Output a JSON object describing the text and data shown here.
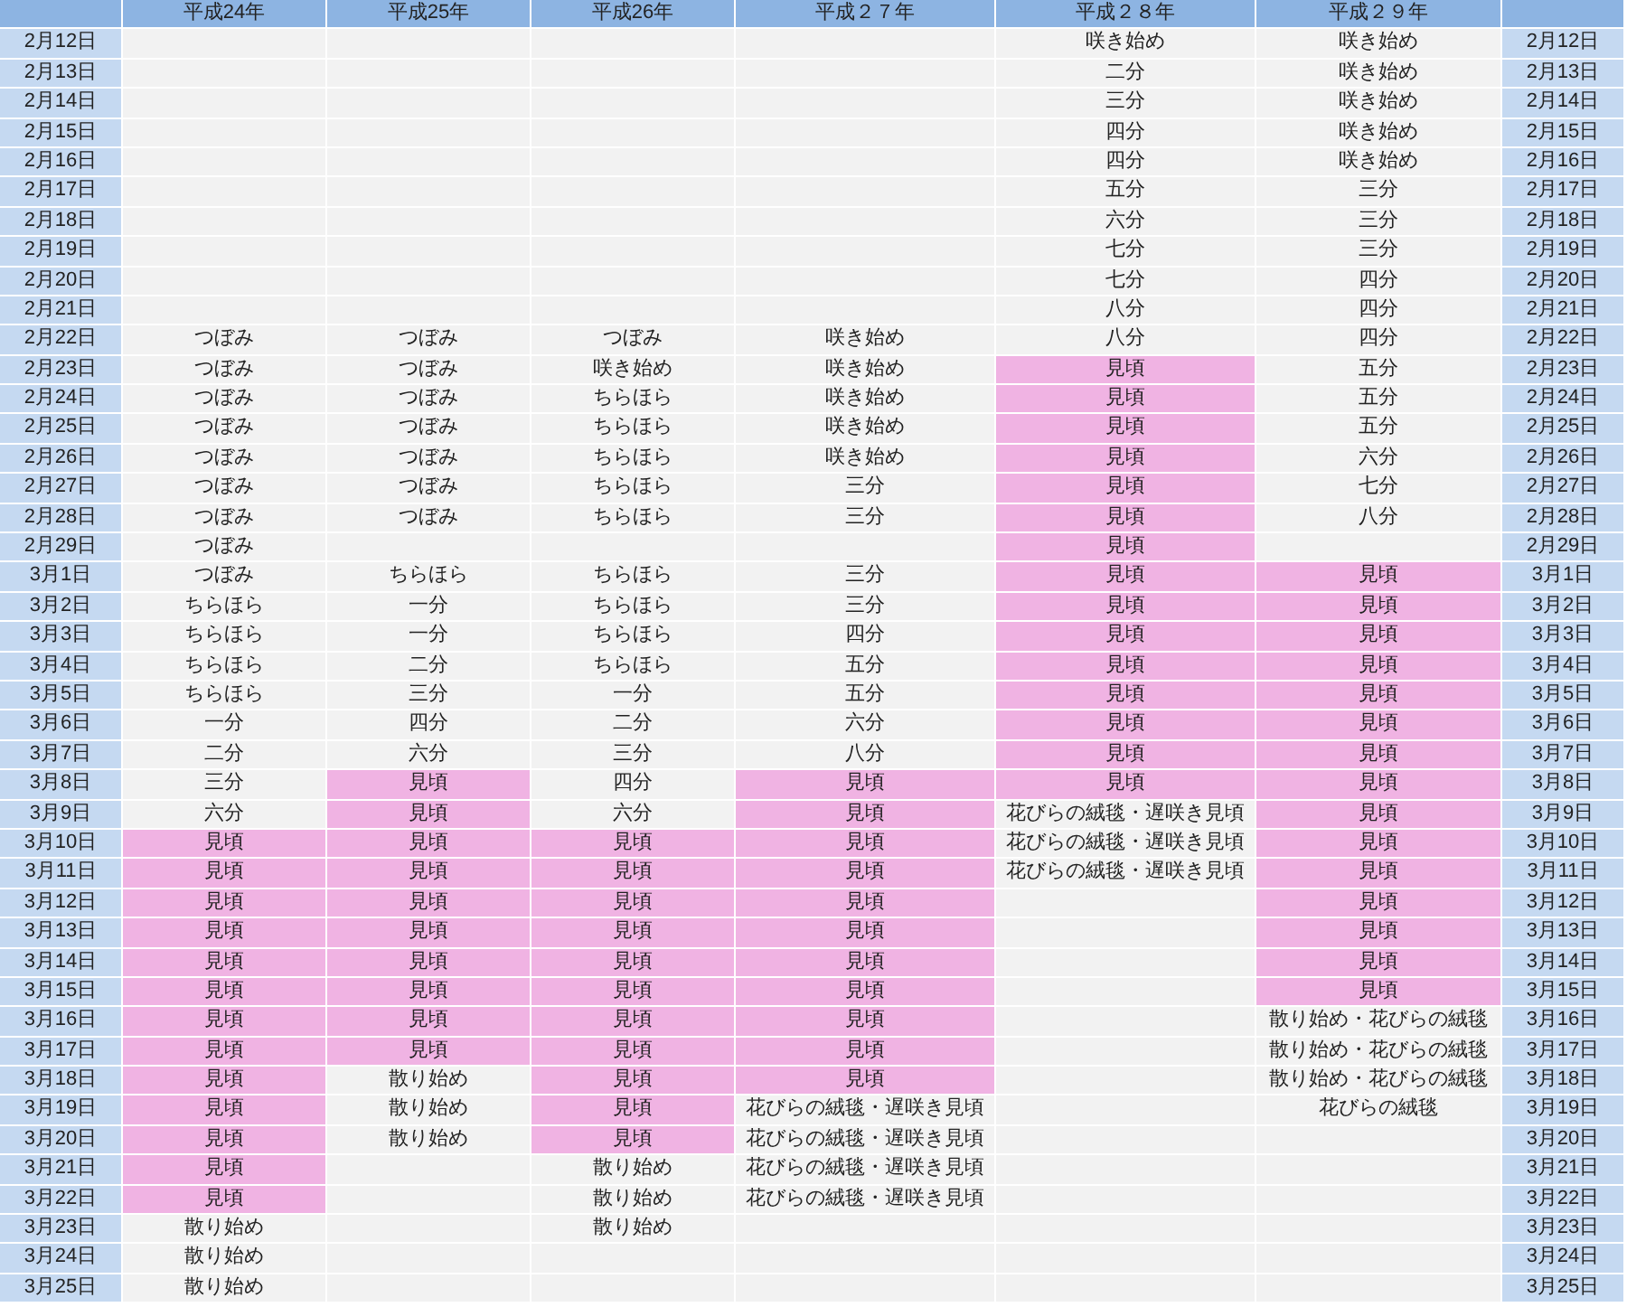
{
  "columns": [
    "平成24年",
    "平成25年",
    "平成26年",
    "平成２７年",
    "平成２８年",
    "平成２９年"
  ],
  "rows": [
    {
      "date": "2月12日",
      "cells": [
        null,
        null,
        null,
        null,
        {
          "text": "咲き始め",
          "highlighted": false
        },
        {
          "text": "咲き始め",
          "highlighted": false
        }
      ],
      "date_right": "2月12日"
    },
    {
      "date": "2月13日",
      "cells": [
        null,
        null,
        null,
        null,
        {
          "text": "二分",
          "highlighted": false
        },
        {
          "text": "咲き始め",
          "highlighted": false
        }
      ],
      "date_right": "2月13日"
    },
    {
      "date": "2月14日",
      "cells": [
        null,
        null,
        null,
        null,
        {
          "text": "三分",
          "highlighted": false
        },
        {
          "text": "咲き始め",
          "highlighted": false
        }
      ],
      "date_right": "2月14日"
    },
    {
      "date": "2月15日",
      "cells": [
        null,
        null,
        null,
        null,
        {
          "text": "四分",
          "highlighted": false
        },
        {
          "text": "咲き始め",
          "highlighted": false
        }
      ],
      "date_right": "2月15日"
    },
    {
      "date": "2月16日",
      "cells": [
        null,
        null,
        null,
        null,
        {
          "text": "四分",
          "highlighted": false
        },
        {
          "text": "咲き始め",
          "highlighted": false
        }
      ],
      "date_right": "2月16日"
    },
    {
      "date": "2月17日",
      "cells": [
        null,
        null,
        null,
        null,
        {
          "text": "五分",
          "highlighted": false
        },
        {
          "text": "三分",
          "highlighted": false
        }
      ],
      "date_right": "2月17日"
    },
    {
      "date": "2月18日",
      "cells": [
        null,
        null,
        null,
        null,
        {
          "text": "六分",
          "highlighted": false
        },
        {
          "text": "三分",
          "highlighted": false
        }
      ],
      "date_right": "2月18日"
    },
    {
      "date": "2月19日",
      "cells": [
        null,
        null,
        null,
        null,
        {
          "text": "七分",
          "highlighted": false
        },
        {
          "text": "三分",
          "highlighted": false
        }
      ],
      "date_right": "2月19日"
    },
    {
      "date": "2月20日",
      "cells": [
        null,
        null,
        null,
        null,
        {
          "text": "七分",
          "highlighted": false
        },
        {
          "text": "四分",
          "highlighted": false
        }
      ],
      "date_right": "2月20日"
    },
    {
      "date": "2月21日",
      "cells": [
        null,
        null,
        null,
        null,
        {
          "text": "八分",
          "highlighted": false
        },
        {
          "text": "四分",
          "highlighted": false
        }
      ],
      "date_right": "2月21日"
    },
    {
      "date": "2月22日",
      "cells": [
        {
          "text": "つぼみ",
          "highlighted": false
        },
        {
          "text": "つぼみ",
          "highlighted": false
        },
        {
          "text": "つぼみ",
          "highlighted": false
        },
        {
          "text": "咲き始め",
          "highlighted": false
        },
        {
          "text": "八分",
          "highlighted": false
        },
        {
          "text": "四分",
          "highlighted": false
        }
      ],
      "date_right": "2月22日"
    },
    {
      "date": "2月23日",
      "cells": [
        {
          "text": "つぼみ",
          "highlighted": false
        },
        {
          "text": "つぼみ",
          "highlighted": false
        },
        {
          "text": "咲き始め",
          "highlighted": false
        },
        {
          "text": "咲き始め",
          "highlighted": false
        },
        {
          "text": "見頃",
          "highlighted": true
        },
        {
          "text": "五分",
          "highlighted": false
        }
      ],
      "date_right": "2月23日"
    },
    {
      "date": "2月24日",
      "cells": [
        {
          "text": "つぼみ",
          "highlighted": false
        },
        {
          "text": "つぼみ",
          "highlighted": false
        },
        {
          "text": "ちらほら",
          "highlighted": false
        },
        {
          "text": "咲き始め",
          "highlighted": false
        },
        {
          "text": "見頃",
          "highlighted": true
        },
        {
          "text": "五分",
          "highlighted": false
        }
      ],
      "date_right": "2月24日"
    },
    {
      "date": "2月25日",
      "cells": [
        {
          "text": "つぼみ",
          "highlighted": false
        },
        {
          "text": "つぼみ",
          "highlighted": false
        },
        {
          "text": "ちらほら",
          "highlighted": false
        },
        {
          "text": "咲き始め",
          "highlighted": false
        },
        {
          "text": "見頃",
          "highlighted": true
        },
        {
          "text": "五分",
          "highlighted": false
        }
      ],
      "date_right": "2月25日"
    },
    {
      "date": "2月26日",
      "cells": [
        {
          "text": "つぼみ",
          "highlighted": false
        },
        {
          "text": "つぼみ",
          "highlighted": false
        },
        {
          "text": "ちらほら",
          "highlighted": false
        },
        {
          "text": "咲き始め",
          "highlighted": false
        },
        {
          "text": "見頃",
          "highlighted": true
        },
        {
          "text": "六分",
          "highlighted": false
        }
      ],
      "date_right": "2月26日"
    },
    {
      "date": "2月27日",
      "cells": [
        {
          "text": "つぼみ",
          "highlighted": false
        },
        {
          "text": "つぼみ",
          "highlighted": false
        },
        {
          "text": "ちらほら",
          "highlighted": false
        },
        {
          "text": "三分",
          "highlighted": false
        },
        {
          "text": "見頃",
          "highlighted": true
        },
        {
          "text": "七分",
          "highlighted": false
        }
      ],
      "date_right": "2月27日"
    },
    {
      "date": "2月28日",
      "cells": [
        {
          "text": "つぼみ",
          "highlighted": false
        },
        {
          "text": "つぼみ",
          "highlighted": false
        },
        {
          "text": "ちらほら",
          "highlighted": false
        },
        {
          "text": "三分",
          "highlighted": false
        },
        {
          "text": "見頃",
          "highlighted": true
        },
        {
          "text": "八分",
          "highlighted": false
        }
      ],
      "date_right": "2月28日"
    },
    {
      "date": "2月29日",
      "cells": [
        {
          "text": "つぼみ",
          "highlighted": false
        },
        null,
        null,
        null,
        {
          "text": "見頃",
          "highlighted": true
        },
        null
      ],
      "date_right": "2月29日"
    },
    {
      "date": "3月1日",
      "cells": [
        {
          "text": "つぼみ",
          "highlighted": false
        },
        {
          "text": "ちらほら",
          "highlighted": false
        },
        {
          "text": "ちらほら",
          "highlighted": false
        },
        {
          "text": "三分",
          "highlighted": false
        },
        {
          "text": "見頃",
          "highlighted": true
        },
        {
          "text": "見頃",
          "highlighted": true
        }
      ],
      "date_right": "3月1日"
    },
    {
      "date": "3月2日",
      "cells": [
        {
          "text": "ちらほら",
          "highlighted": false
        },
        {
          "text": "一分",
          "highlighted": false
        },
        {
          "text": "ちらほら",
          "highlighted": false
        },
        {
          "text": "三分",
          "highlighted": false
        },
        {
          "text": "見頃",
          "highlighted": true
        },
        {
          "text": "見頃",
          "highlighted": true
        }
      ],
      "date_right": "3月2日"
    },
    {
      "date": "3月3日",
      "cells": [
        {
          "text": "ちらほら",
          "highlighted": false
        },
        {
          "text": "一分",
          "highlighted": false
        },
        {
          "text": "ちらほら",
          "highlighted": false
        },
        {
          "text": "四分",
          "highlighted": false
        },
        {
          "text": "見頃",
          "highlighted": true
        },
        {
          "text": "見頃",
          "highlighted": true
        }
      ],
      "date_right": "3月3日"
    },
    {
      "date": "3月4日",
      "cells": [
        {
          "text": "ちらほら",
          "highlighted": false
        },
        {
          "text": "二分",
          "highlighted": false
        },
        {
          "text": "ちらほら",
          "highlighted": false
        },
        {
          "text": "五分",
          "highlighted": false
        },
        {
          "text": "見頃",
          "highlighted": true
        },
        {
          "text": "見頃",
          "highlighted": true
        }
      ],
      "date_right": "3月4日"
    },
    {
      "date": "3月5日",
      "cells": [
        {
          "text": "ちらほら",
          "highlighted": false
        },
        {
          "text": "三分",
          "highlighted": false
        },
        {
          "text": "一分",
          "highlighted": false
        },
        {
          "text": "五分",
          "highlighted": false
        },
        {
          "text": "見頃",
          "highlighted": true
        },
        {
          "text": "見頃",
          "highlighted": true
        }
      ],
      "date_right": "3月5日"
    },
    {
      "date": "3月6日",
      "cells": [
        {
          "text": "一分",
          "highlighted": false
        },
        {
          "text": "四分",
          "highlighted": false
        },
        {
          "text": "二分",
          "highlighted": false
        },
        {
          "text": "六分",
          "highlighted": false
        },
        {
          "text": "見頃",
          "highlighted": true
        },
        {
          "text": "見頃",
          "highlighted": true
        }
      ],
      "date_right": "3月6日"
    },
    {
      "date": "3月7日",
      "cells": [
        {
          "text": "二分",
          "highlighted": false
        },
        {
          "text": "六分",
          "highlighted": false
        },
        {
          "text": "三分",
          "highlighted": false
        },
        {
          "text": "八分",
          "highlighted": false
        },
        {
          "text": "見頃",
          "highlighted": true
        },
        {
          "text": "見頃",
          "highlighted": true
        }
      ],
      "date_right": "3月7日"
    },
    {
      "date": "3月8日",
      "cells": [
        {
          "text": "三分",
          "highlighted": false
        },
        {
          "text": "見頃",
          "highlighted": true
        },
        {
          "text": "四分",
          "highlighted": false
        },
        {
          "text": "見頃",
          "highlighted": true
        },
        {
          "text": "見頃",
          "highlighted": true
        },
        {
          "text": "見頃",
          "highlighted": true
        }
      ],
      "date_right": "3月8日"
    },
    {
      "date": "3月9日",
      "cells": [
        {
          "text": "六分",
          "highlighted": false
        },
        {
          "text": "見頃",
          "highlighted": true
        },
        {
          "text": "六分",
          "highlighted": false
        },
        {
          "text": "見頃",
          "highlighted": true
        },
        {
          "text": "花びらの絨毯・遅咲き見頃",
          "highlighted": false
        },
        {
          "text": "見頃",
          "highlighted": true
        }
      ],
      "date_right": "3月9日"
    },
    {
      "date": "3月10日",
      "cells": [
        {
          "text": "見頃",
          "highlighted": true
        },
        {
          "text": "見頃",
          "highlighted": true
        },
        {
          "text": "見頃",
          "highlighted": true
        },
        {
          "text": "見頃",
          "highlighted": true
        },
        {
          "text": "花びらの絨毯・遅咲き見頃",
          "highlighted": false
        },
        {
          "text": "見頃",
          "highlighted": true
        }
      ],
      "date_right": "3月10日"
    },
    {
      "date": "3月11日",
      "cells": [
        {
          "text": "見頃",
          "highlighted": true
        },
        {
          "text": "見頃",
          "highlighted": true
        },
        {
          "text": "見頃",
          "highlighted": true
        },
        {
          "text": "見頃",
          "highlighted": true
        },
        {
          "text": "花びらの絨毯・遅咲き見頃",
          "highlighted": false
        },
        {
          "text": "見頃",
          "highlighted": true
        }
      ],
      "date_right": "3月11日"
    },
    {
      "date": "3月12日",
      "cells": [
        {
          "text": "見頃",
          "highlighted": true
        },
        {
          "text": "見頃",
          "highlighted": true
        },
        {
          "text": "見頃",
          "highlighted": true
        },
        {
          "text": "見頃",
          "highlighted": true
        },
        null,
        {
          "text": "見頃",
          "highlighted": true
        }
      ],
      "date_right": "3月12日"
    },
    {
      "date": "3月13日",
      "cells": [
        {
          "text": "見頃",
          "highlighted": true
        },
        {
          "text": "見頃",
          "highlighted": true
        },
        {
          "text": "見頃",
          "highlighted": true
        },
        {
          "text": "見頃",
          "highlighted": true
        },
        null,
        {
          "text": "見頃",
          "highlighted": true
        }
      ],
      "date_right": "3月13日"
    },
    {
      "date": "3月14日",
      "cells": [
        {
          "text": "見頃",
          "highlighted": true
        },
        {
          "text": "見頃",
          "highlighted": true
        },
        {
          "text": "見頃",
          "highlighted": true
        },
        {
          "text": "見頃",
          "highlighted": true
        },
        null,
        {
          "text": "見頃",
          "highlighted": true
        }
      ],
      "date_right": "3月14日"
    },
    {
      "date": "3月15日",
      "cells": [
        {
          "text": "見頃",
          "highlighted": true
        },
        {
          "text": "見頃",
          "highlighted": true
        },
        {
          "text": "見頃",
          "highlighted": true
        },
        {
          "text": "見頃",
          "highlighted": true
        },
        null,
        {
          "text": "見頃",
          "highlighted": true
        }
      ],
      "date_right": "3月15日"
    },
    {
      "date": "3月16日",
      "cells": [
        {
          "text": "見頃",
          "highlighted": true
        },
        {
          "text": "見頃",
          "highlighted": true
        },
        {
          "text": "見頃",
          "highlighted": true
        },
        {
          "text": "見頃",
          "highlighted": true
        },
        null,
        {
          "text": "散り始め・花びらの絨毯",
          "highlighted": false
        }
      ],
      "date_right": "3月16日"
    },
    {
      "date": "3月17日",
      "cells": [
        {
          "text": "見頃",
          "highlighted": true
        },
        {
          "text": "見頃",
          "highlighted": true
        },
        {
          "text": "見頃",
          "highlighted": true
        },
        {
          "text": "見頃",
          "highlighted": true
        },
        null,
        {
          "text": "散り始め・花びらの絨毯",
          "highlighted": false
        }
      ],
      "date_right": "3月17日"
    },
    {
      "date": "3月18日",
      "cells": [
        {
          "text": "見頃",
          "highlighted": true
        },
        {
          "text": "散り始め",
          "highlighted": false
        },
        {
          "text": "見頃",
          "highlighted": true
        },
        {
          "text": "見頃",
          "highlighted": true
        },
        null,
        {
          "text": "散り始め・花びらの絨毯",
          "highlighted": false
        }
      ],
      "date_right": "3月18日"
    },
    {
      "date": "3月19日",
      "cells": [
        {
          "text": "見頃",
          "highlighted": true
        },
        {
          "text": "散り始め",
          "highlighted": false
        },
        {
          "text": "見頃",
          "highlighted": true
        },
        {
          "text": "花びらの絨毯・遅咲き見頃",
          "highlighted": false
        },
        null,
        {
          "text": "花びらの絨毯",
          "highlighted": false
        }
      ],
      "date_right": "3月19日"
    },
    {
      "date": "3月20日",
      "cells": [
        {
          "text": "見頃",
          "highlighted": true
        },
        {
          "text": "散り始め",
          "highlighted": false
        },
        {
          "text": "見頃",
          "highlighted": true
        },
        {
          "text": "花びらの絨毯・遅咲き見頃",
          "highlighted": false
        },
        null,
        null
      ],
      "date_right": "3月20日"
    },
    {
      "date": "3月21日",
      "cells": [
        {
          "text": "見頃",
          "highlighted": true
        },
        null,
        {
          "text": "散り始め",
          "highlighted": false
        },
        {
          "text": "花びらの絨毯・遅咲き見頃",
          "highlighted": false
        },
        null,
        null
      ],
      "date_right": "3月21日"
    },
    {
      "date": "3月22日",
      "cells": [
        {
          "text": "見頃",
          "highlighted": true
        },
        null,
        {
          "text": "散り始め",
          "highlighted": false
        },
        {
          "text": "花びらの絨毯・遅咲き見頃",
          "highlighted": false
        },
        null,
        null
      ],
      "date_right": "3月22日"
    },
    {
      "date": "3月23日",
      "cells": [
        {
          "text": "散り始め",
          "highlighted": false
        },
        null,
        {
          "text": "散り始め",
          "highlighted": false
        },
        null,
        null,
        null
      ],
      "date_right": "3月23日"
    },
    {
      "date": "3月24日",
      "cells": [
        {
          "text": "散り始め",
          "highlighted": false
        },
        null,
        null,
        null,
        null,
        null
      ],
      "date_right": "3月24日"
    },
    {
      "date": "3月25日",
      "cells": [
        {
          "text": "散り始め",
          "highlighted": false
        },
        null,
        null,
        null,
        null,
        null
      ],
      "date_right": "3月25日"
    }
  ]
}
